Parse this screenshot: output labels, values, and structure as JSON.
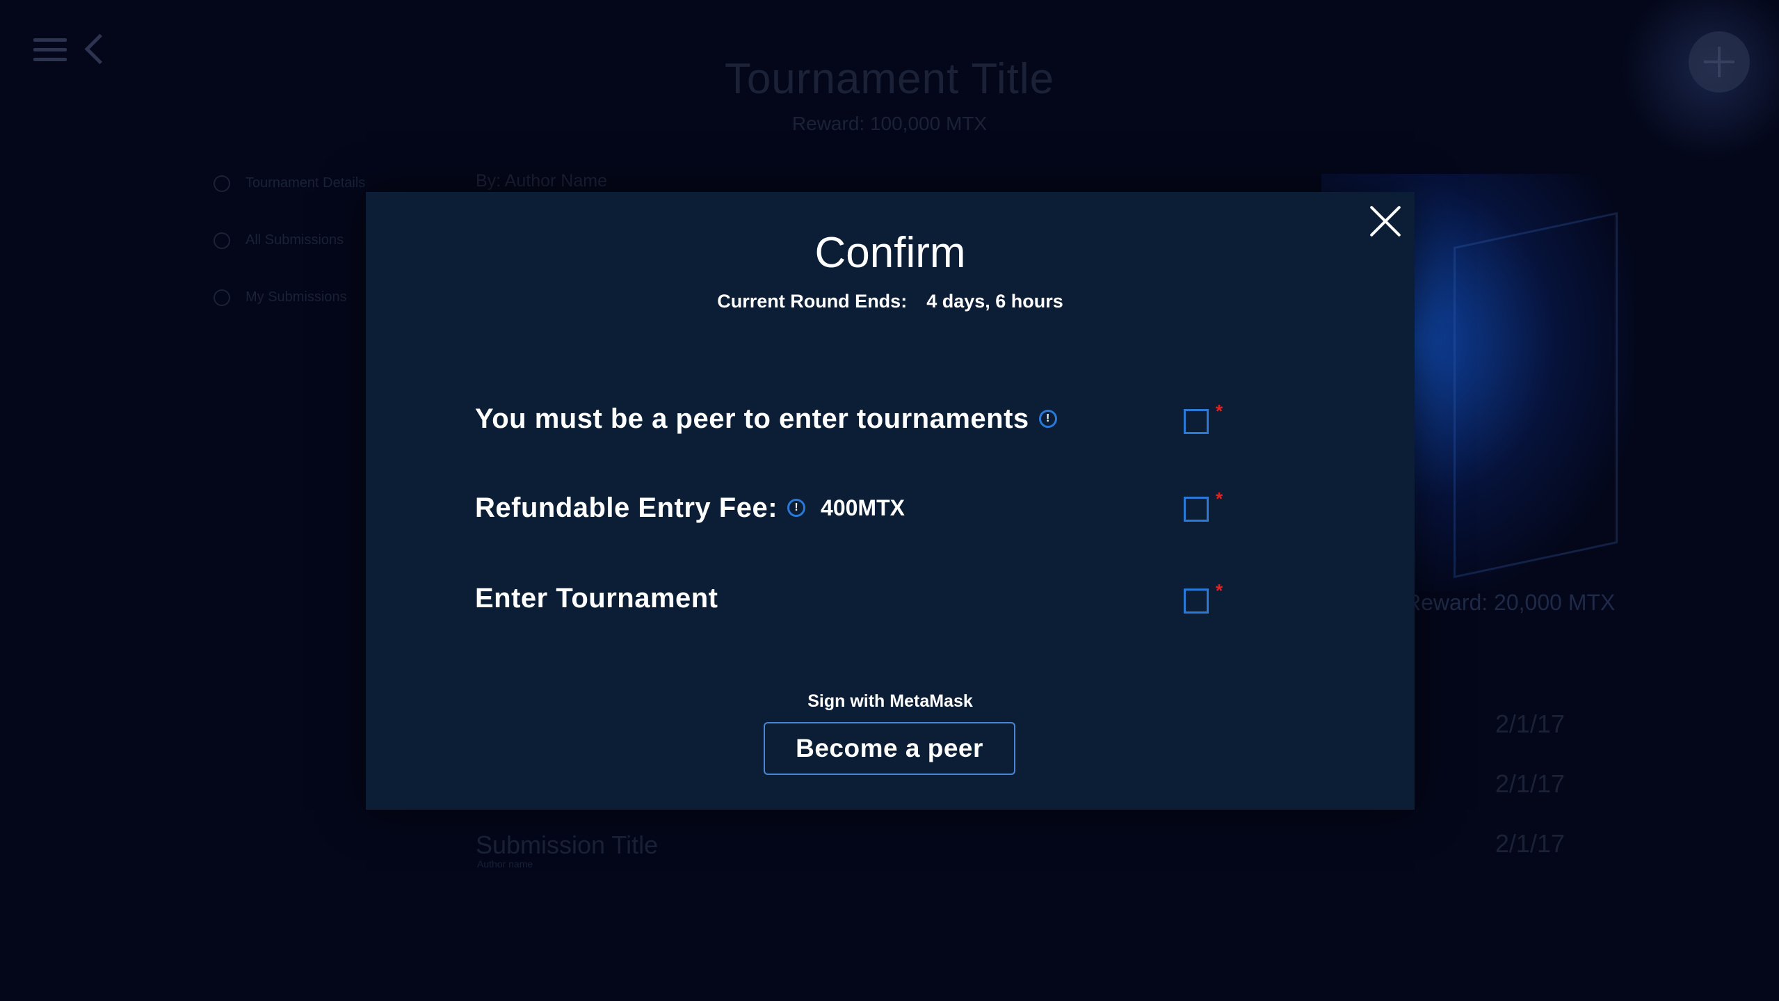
{
  "background": {
    "page_title": "Tournament Title",
    "reward": "Reward: 100,000 MTX",
    "side_nav": [
      "Tournament Details",
      "All Submissions",
      "My Submissions"
    ],
    "author": "By: Author Name",
    "right_reward": "Reward: 20,000 MTX",
    "dates": [
      "2/1/17",
      "2/1/17",
      "2/1/17"
    ],
    "submission_title": "Submission Title",
    "submission_author": "Author name"
  },
  "modal": {
    "title": "Confirm",
    "round_label": "Current Round Ends:",
    "round_value": "4 days, 6 hours",
    "rows": [
      {
        "label": "You must be a peer to enter tournaments",
        "value": "",
        "required": "*",
        "checked": false
      },
      {
        "label": "Refundable Entry Fee:",
        "value": "400MTX",
        "required": "*",
        "checked": false
      },
      {
        "label": "Enter Tournament",
        "value": "",
        "required": "*",
        "checked": false
      }
    ],
    "sign_label": "Sign with MetaMask",
    "button_label": "Become a peer"
  },
  "colors": {
    "background": "#04071a",
    "modal": "#0b1e35",
    "accent": "#2b79d6",
    "required": "#e02424"
  },
  "icons": {
    "menu": "hamburger-menu-icon",
    "back": "chevron-left-icon",
    "close": "close-icon",
    "info": "info-icon",
    "avatar": "user-avatar-icon"
  }
}
